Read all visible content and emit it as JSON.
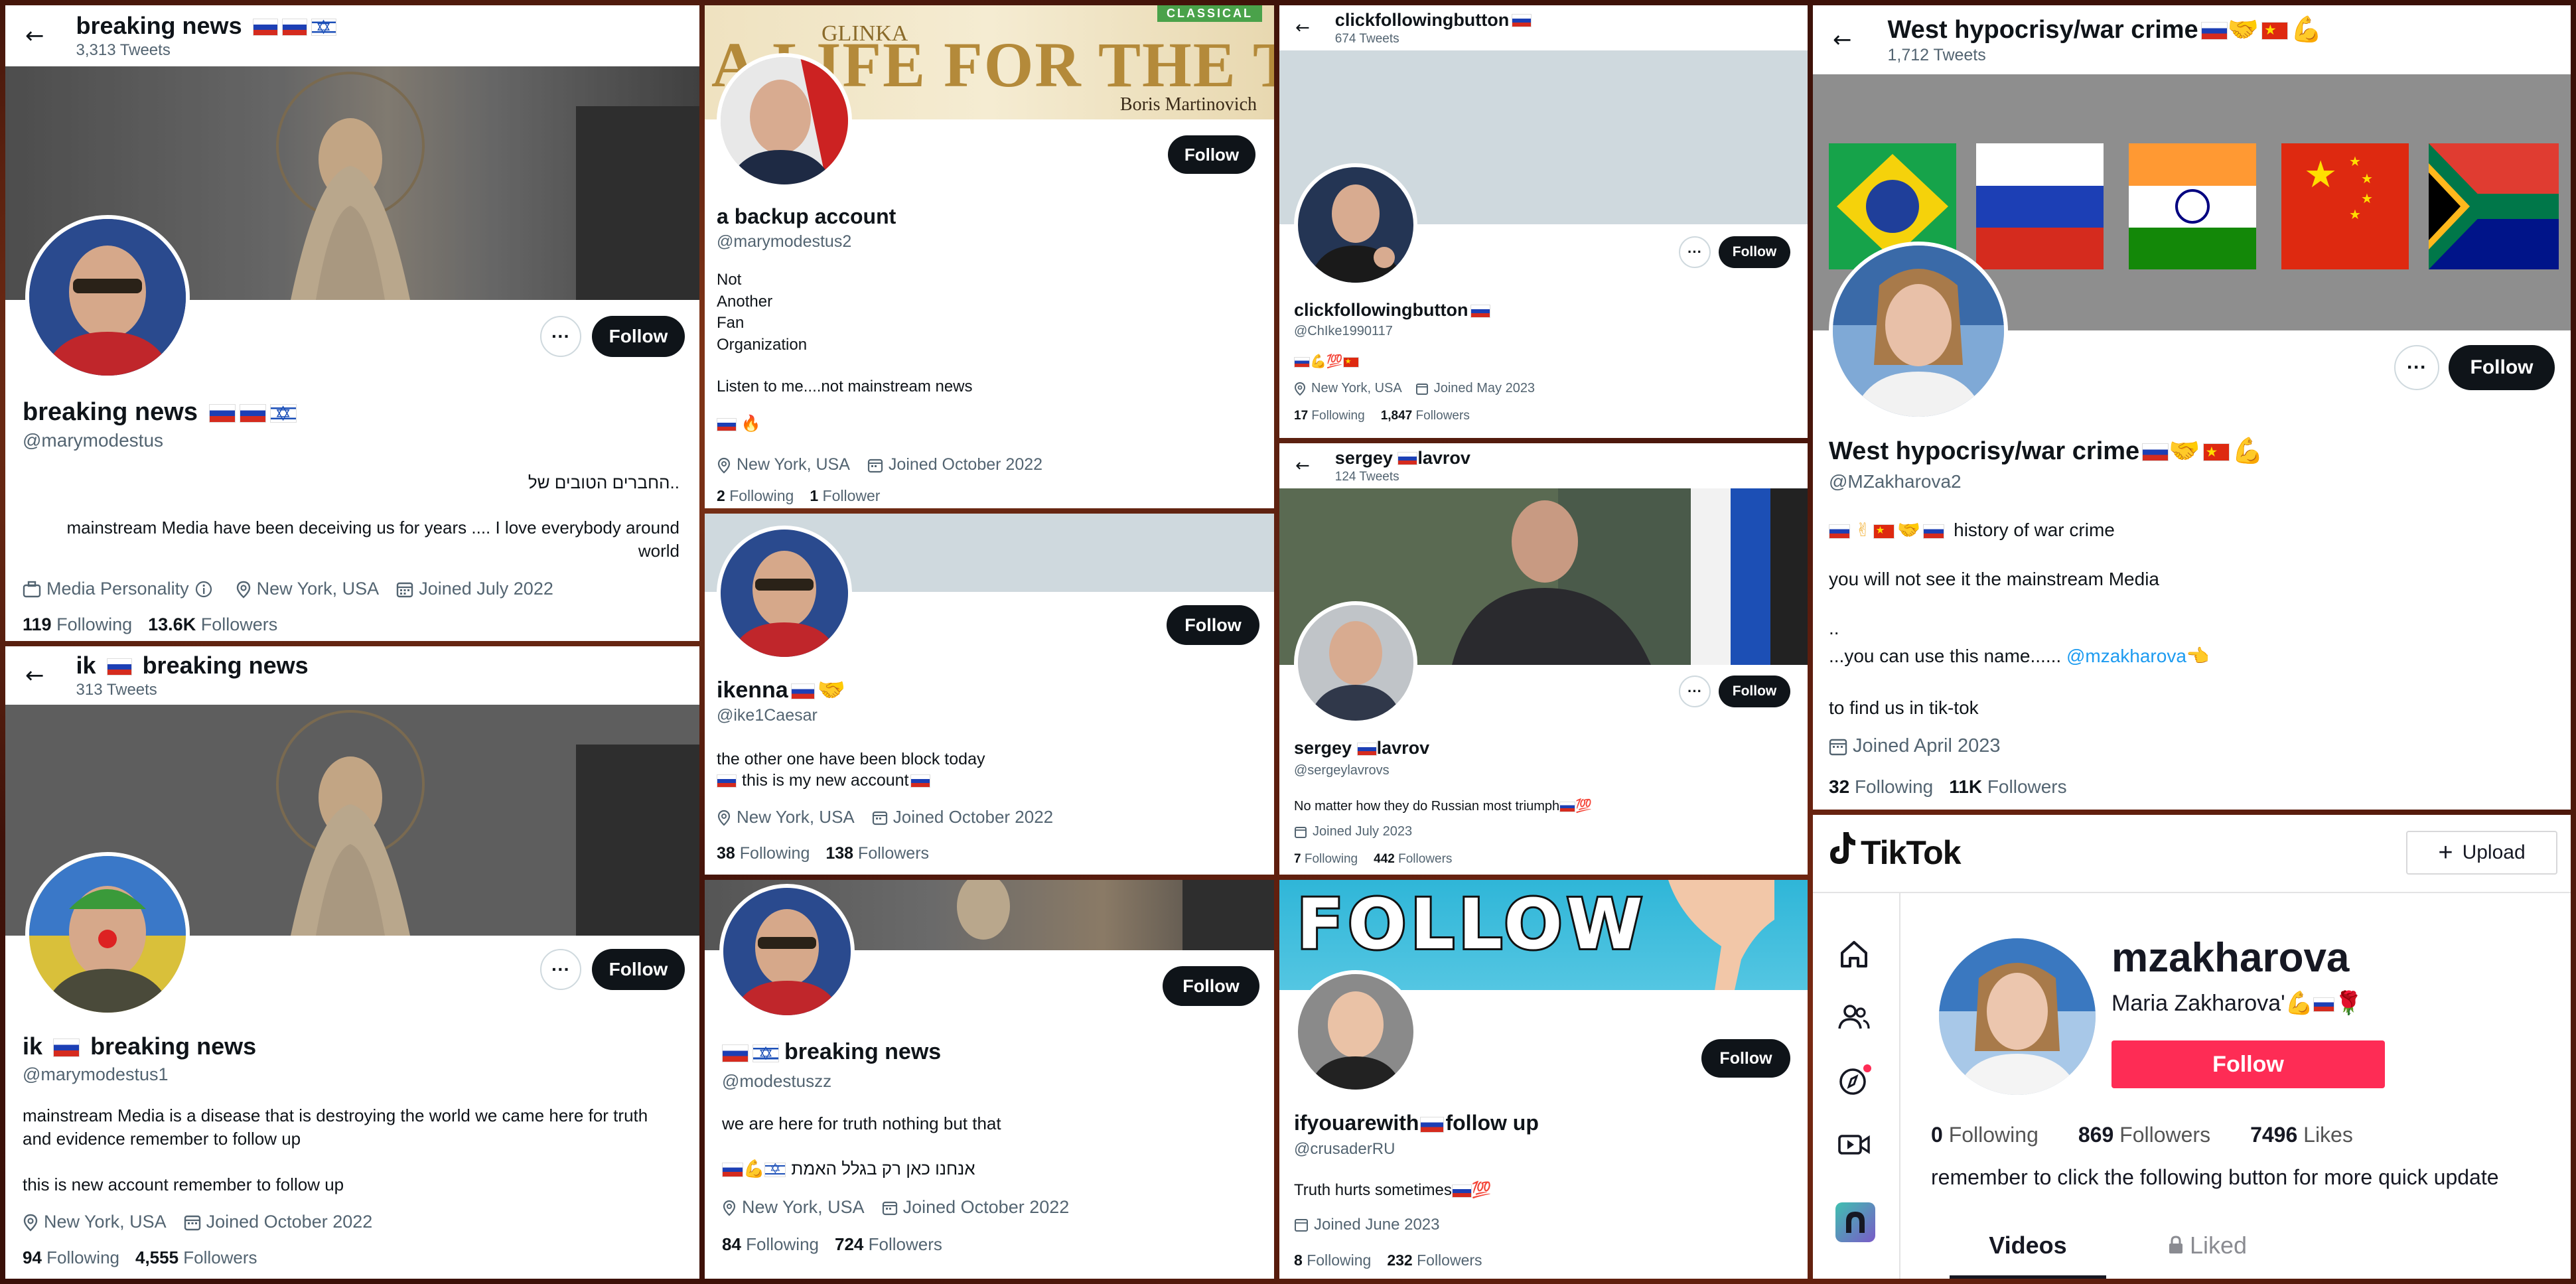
{
  "p1": {
    "title": "breaking news",
    "tweets": "3,313 Tweets",
    "name": "breaking news",
    "handle": "@marymodestus",
    "bio_line1": "..החברים הטובים של",
    "bio_line2": "mainstream Media have been deceiving us for years .... I  love everybody around world",
    "category": "Media Personality",
    "location": "New York, USA",
    "joined": "Joined July 2022",
    "following_count": "119",
    "following_label": "Following",
    "followers_count": "13.6K",
    "followers_label": "Followers",
    "follow_label": "Follow"
  },
  "p2": {
    "banner_text1": "GLINKA",
    "banner_text2": "A LIFE FOR THE TSAR",
    "banner_text3": "Boris Martinovich",
    "banner_tag": "CLASSICAL",
    "name": "a backup account",
    "handle": "@marymodestus2",
    "bio": [
      "Not",
      "Another",
      "Fan",
      "Organization",
      "",
      "Listen to me....not mainstream news",
      "",
      "🇷🇺 🔥"
    ],
    "location": "New York, USA",
    "joined": "Joined October 2022",
    "following_count": "2",
    "following_label": "Following",
    "followers_count": "1",
    "followers_label": "Follower",
    "follow_label": "Follow"
  },
  "p3": {
    "title": "clickfollowingbutton",
    "tweets": "674 Tweets",
    "name": "clickfollowingbutton",
    "handle": "@ChIke1990117",
    "bio": "💪💯",
    "location": "New York, USA",
    "joined": "Joined May 2023",
    "following_count": "17",
    "following_label": "Following",
    "followers_count": "1,847",
    "followers_label": "Followers",
    "follow_label": "Follow"
  },
  "p4": {
    "title": "West hypocrisy/war crime",
    "tweets": "1,712 Tweets",
    "name": "West hypocrisy/war crime",
    "handle": "@MZakharova2",
    "bio1": "history of war crime",
    "bio2": "you will not see it the mainstream Media",
    "bio3": "..",
    "bio4a": "...you can use this name......",
    "bio4b": "@mzakharova👈",
    "bio5": "to find us in tik-tok",
    "joined": "Joined April 2023",
    "following_count": "32",
    "following_label": "Following",
    "followers_count": "11K",
    "followers_label": "Followers",
    "follow_label": "Follow"
  },
  "p5": {
    "name": "ikenna",
    "handle": "@ike1Caesar",
    "bio1": "the other one have been block today",
    "bio2": "this is my new account",
    "location": "New York, USA",
    "joined": "Joined October 2022",
    "following_count": "38",
    "following_label": "Following",
    "followers_count": "138",
    "followers_label": "Followers",
    "follow_label": "Follow"
  },
  "p6": {
    "title": "sergey",
    "title2": "lavrov",
    "tweets": "124 Tweets",
    "name": "sergey",
    "name2": "lavrov",
    "handle": "@sergeylavrovs",
    "bio": "No matter how  they do Russian most triumph",
    "joined": "Joined July 2023",
    "following_count": "7",
    "following_label": "Following",
    "followers_count": "442",
    "followers_label": "Followers",
    "follow_label": "Follow"
  },
  "p7": {
    "title": "ik",
    "title2": "breaking news",
    "tweets": "313 Tweets",
    "name": "ik",
    "name2": "breaking news",
    "handle": "@marymodestus1",
    "bio1": "mainstream Media is a disease that is destroying the world we came here for truth and evidence remember to follow up",
    "bio2": "this is new account remember to follow up",
    "location": "New York, USA",
    "joined": "Joined October 2022",
    "following_count": "94",
    "following_label": "Following",
    "followers_count": "4,555",
    "followers_label": "Followers",
    "follow_label": "Follow"
  },
  "p8": {
    "name": "breaking news",
    "handle": "@modestuszz",
    "bio1": "we are here for truth nothing but that",
    "bio2": "אנחנו כאן רק בגלל האמת",
    "location": "New York, USA",
    "joined": "Joined October 2022",
    "following_count": "84",
    "following_label": "Following",
    "followers_count": "724",
    "followers_label": "Followers",
    "follow_label": "Follow"
  },
  "p9": {
    "banner_text": "FOLLOW",
    "name": "ifyouarewith",
    "name2": "follow up",
    "handle": "@crusaderRU",
    "bio": "Truth hurts sometimes",
    "joined": "Joined June 2023",
    "following_count": "8",
    "following_label": "Following",
    "followers_count": "232",
    "followers_label": "Followers",
    "follow_label": "Follow"
  },
  "tiktok": {
    "brand": "TikTok",
    "upload_label": "Upload",
    "username": "mzakharova",
    "display_name": "Maria Zakharova'",
    "follow_label": "Follow",
    "following_count": "0",
    "following_label": "Following",
    "followers_count": "869",
    "followers_label": "Followers",
    "likes_count": "7496",
    "likes_label": "Likes",
    "bio": "remember to click the following button for more quick update",
    "tab_videos": "Videos",
    "tab_liked": "Liked"
  },
  "colors": {
    "twitter_text": "#0f1419",
    "twitter_muted": "#536471",
    "link_blue": "#1d9bf0",
    "tiktok_red": "#fe2c55",
    "banner_gray": "#cfd9de"
  }
}
